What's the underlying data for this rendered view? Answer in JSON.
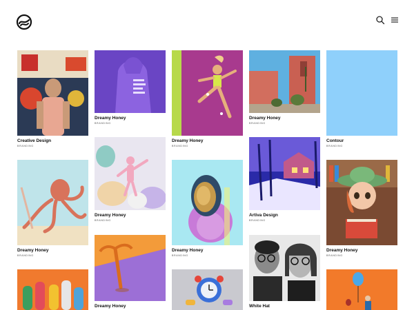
{
  "header": {
    "logo_icon": "circle-swoosh-logo",
    "search_icon": "search-icon",
    "menu_icon": "hamburger-menu-icon"
  },
  "portfolio": {
    "items": [
      {
        "title": "Creative Design",
        "category": "BRANDING"
      },
      {
        "title": "Dreamy Honey",
        "category": "BRANDING"
      },
      {
        "title": "Dreamy Honey",
        "category": "BRANDING"
      },
      {
        "title": "Dreamy Honey",
        "category": "BRANDING"
      },
      {
        "title": "Contour",
        "category": "BRANDING"
      },
      {
        "title": "Dreamy Honey",
        "category": "BRANDING"
      },
      {
        "title": "Dreamy Honey",
        "category": "BRANDING"
      },
      {
        "title": "Dreamy Honey",
        "category": "BRANDING"
      },
      {
        "title": "Artiva Design",
        "category": "BRANDING"
      },
      {
        "title": "Dreamy Honey",
        "category": "BRANDING"
      },
      {
        "title": "Dreamy Honey",
        "category": ""
      },
      {
        "title": "White Hat",
        "category": ""
      }
    ]
  },
  "colors": {
    "text": "#111111",
    "subtext": "#555555",
    "background": "#ffffff"
  }
}
